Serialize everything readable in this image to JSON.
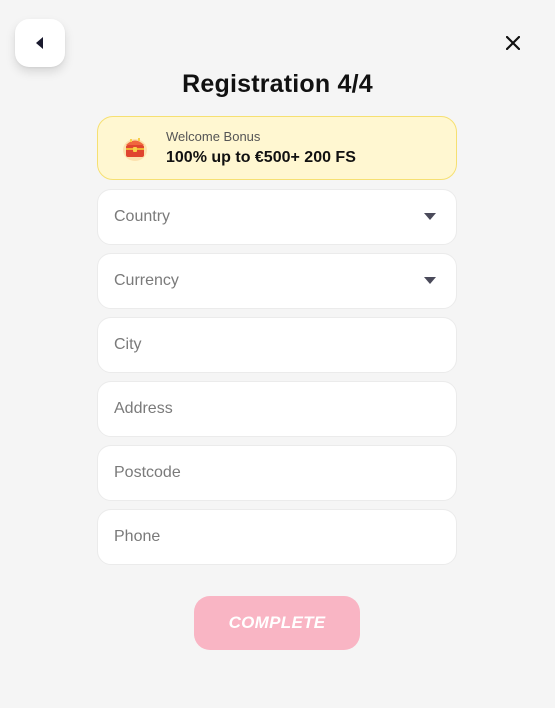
{
  "header": {
    "title": "Registration 4/4",
    "back_icon": "chevron-left-icon",
    "close_icon": "close-icon"
  },
  "bonus": {
    "icon": "treasure-chest-icon",
    "caption": "Welcome Bonus",
    "offer": "100% up to €500+ 200 FS"
  },
  "form": {
    "country": {
      "label": "Country",
      "icon": "caret-down-icon"
    },
    "currency": {
      "label": "Currency",
      "icon": "caret-down-icon"
    },
    "city": {
      "placeholder": "City",
      "value": ""
    },
    "address": {
      "placeholder": "Address",
      "value": ""
    },
    "postcode": {
      "placeholder": "Postcode",
      "value": ""
    },
    "phone": {
      "placeholder": "Phone",
      "value": ""
    }
  },
  "actions": {
    "complete_label": "COMPLETE"
  },
  "colors": {
    "background": "#f5f5f5",
    "bonus_bg": "#fff7d1",
    "bonus_border": "#f6e072",
    "complete_bg": "#f9b5c4"
  }
}
